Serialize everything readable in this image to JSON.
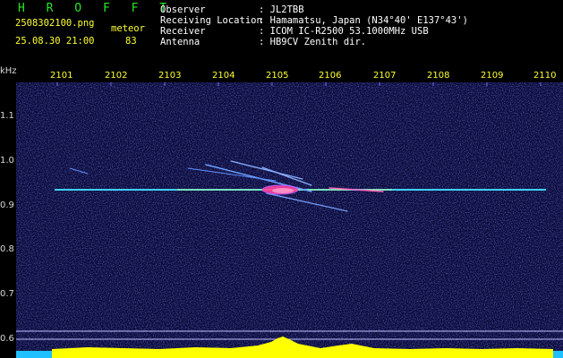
{
  "app": {
    "title": "H R O F F T"
  },
  "file": {
    "name": "2508302100.png",
    "type": "meteor",
    "datetime": "25.08.30 21:00",
    "count": "83"
  },
  "info": [
    {
      "label": "Observer",
      "value": ": JL2TBB"
    },
    {
      "label": "Receiving Location",
      "value": ": Hamamatsu, Japan (N34°40' E137°43')"
    },
    {
      "label": "Receiver",
      "value": ": ICOM IC-R2500 53.1000MHz USB"
    },
    {
      "label": "Antenna",
      "value": ": HB9CV Zenith dir."
    }
  ],
  "axes": {
    "y_unit": "kHz",
    "y_ticks": [
      "1.1",
      "1.0",
      "0.9",
      "0.8",
      "0.7",
      "0.6"
    ],
    "x_ticks": [
      "2101",
      "2102",
      "2103",
      "2104",
      "2105",
      "2106",
      "2107",
      "2108",
      "2109",
      "2110"
    ]
  },
  "colors": {
    "title": "#27e627",
    "header_text": "#ffff33",
    "label": "#ffffff",
    "background": "#000000",
    "spectrum_bg": "#0a0a3a",
    "carrier": "#3fd0ff",
    "meteor": "#ff3fa0",
    "level": "#ffff00"
  }
}
